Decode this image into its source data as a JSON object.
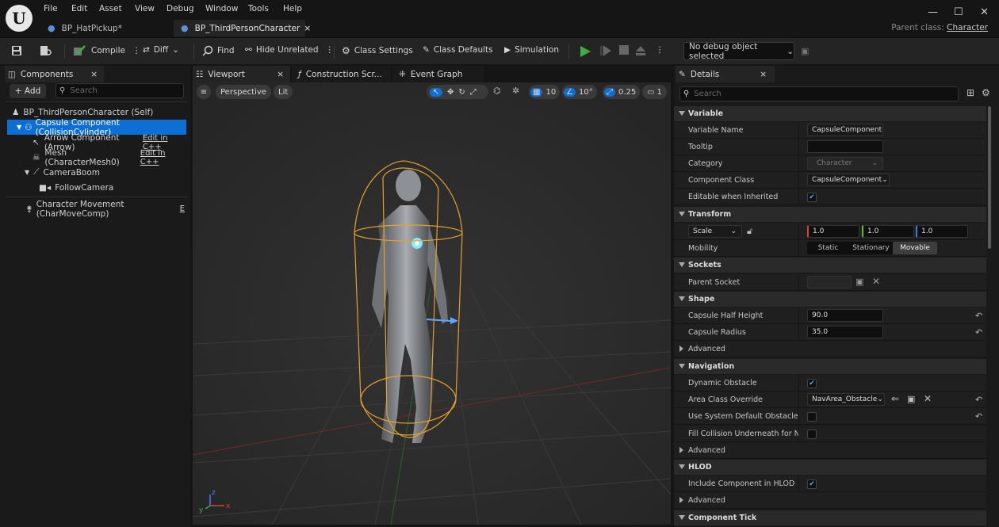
{
  "menu": [
    "File",
    "Edit",
    "Asset",
    "View",
    "Debug",
    "Window",
    "Tools",
    "Help"
  ],
  "doc_tabs": [
    {
      "label": "BP_HatPickup*"
    },
    {
      "label": "BP_ThirdPersonCharacter",
      "close": "×"
    }
  ],
  "parent_class": {
    "label": "Parent class:",
    "value": "Character"
  },
  "toolbar": {
    "compile": "Compile",
    "diff": "Diff",
    "find": "Find",
    "hide_unrelated": "Hide Unrelated",
    "class_settings": "Class Settings",
    "class_defaults": "Class Defaults",
    "simulation": "Simulation",
    "debug_object": "No debug object selected",
    "play_color": "#3fae3f"
  },
  "components_panel": {
    "tab": "Components",
    "close": "×",
    "add": "+ Add",
    "search_placeholder": "Search",
    "tree": [
      {
        "label": "BP_ThirdPersonCharacter (Self)",
        "icon": "person-icon"
      },
      {
        "label": "Capsule Component (CollisionCylinder)",
        "icon": "capsule-icon",
        "selected": true
      },
      {
        "label": "Arrow Component (Arrow)",
        "icon": "arrow-icon",
        "edit": "Edit in C++"
      },
      {
        "label": "Mesh (CharacterMesh0)",
        "icon": "skeleton-icon",
        "edit": "Edit in C++"
      },
      {
        "label": "CameraBoom",
        "icon": "boom-icon"
      },
      {
        "label": "FollowCamera",
        "icon": "camera-icon"
      },
      {
        "label": "Character Movement (CharMoveComp)",
        "icon": "movement-icon",
        "edit": "E"
      }
    ]
  },
  "editor_tabs": [
    {
      "label": "Viewport",
      "close": "×"
    },
    {
      "label": "Construction Scr..."
    },
    {
      "label": "Event Graph"
    }
  ],
  "viewport": {
    "perspective": "Perspective",
    "lit": "Lit",
    "grid_snap": "10",
    "rot_snap": "10°",
    "scale_snap": "0.25",
    "camera_speed": "1",
    "accent": "#0d6fd4"
  },
  "details": {
    "tab": "Details",
    "close": "×",
    "search_placeholder": "Search",
    "variable": {
      "header": "Variable",
      "name_label": "Variable Name",
      "name_value": "CapsuleComponent",
      "tooltip_label": "Tooltip",
      "tooltip_value": "",
      "category_label": "Category",
      "category_value": "Character",
      "component_class_label": "Component Class",
      "component_class_value": "CapsuleComponent",
      "editable_label": "Editable when Inherited"
    },
    "transform": {
      "header": "Transform",
      "scale_label": "Scale",
      "x": "1.0",
      "y": "1.0",
      "z": "1.0",
      "mobility_label": "Mobility",
      "mobility_options": [
        "Static",
        "Stationary",
        "Movable"
      ],
      "mobility_selected": "Movable"
    },
    "sockets": {
      "header": "Sockets",
      "parent_socket_label": "Parent Socket"
    },
    "shape": {
      "header": "Shape",
      "half_height_label": "Capsule Half Height",
      "half_height": "90.0",
      "radius_label": "Capsule Radius",
      "radius": "35.0",
      "advanced": "Advanced"
    },
    "navigation": {
      "header": "Navigation",
      "dynamic_obstacle_label": "Dynamic Obstacle",
      "area_class_label": "Area Class Override",
      "area_class_value": "NavArea_Obstacle",
      "use_default_label": "Use System Default Obstacle Are...",
      "fill_collision_label": "Fill Collision Underneath for Nav...",
      "advanced": "Advanced"
    },
    "hlod": {
      "header": "HLOD",
      "include_label": "Include Component in HLOD",
      "advanced": "Advanced"
    },
    "component_tick": {
      "header": "Component Tick"
    }
  }
}
